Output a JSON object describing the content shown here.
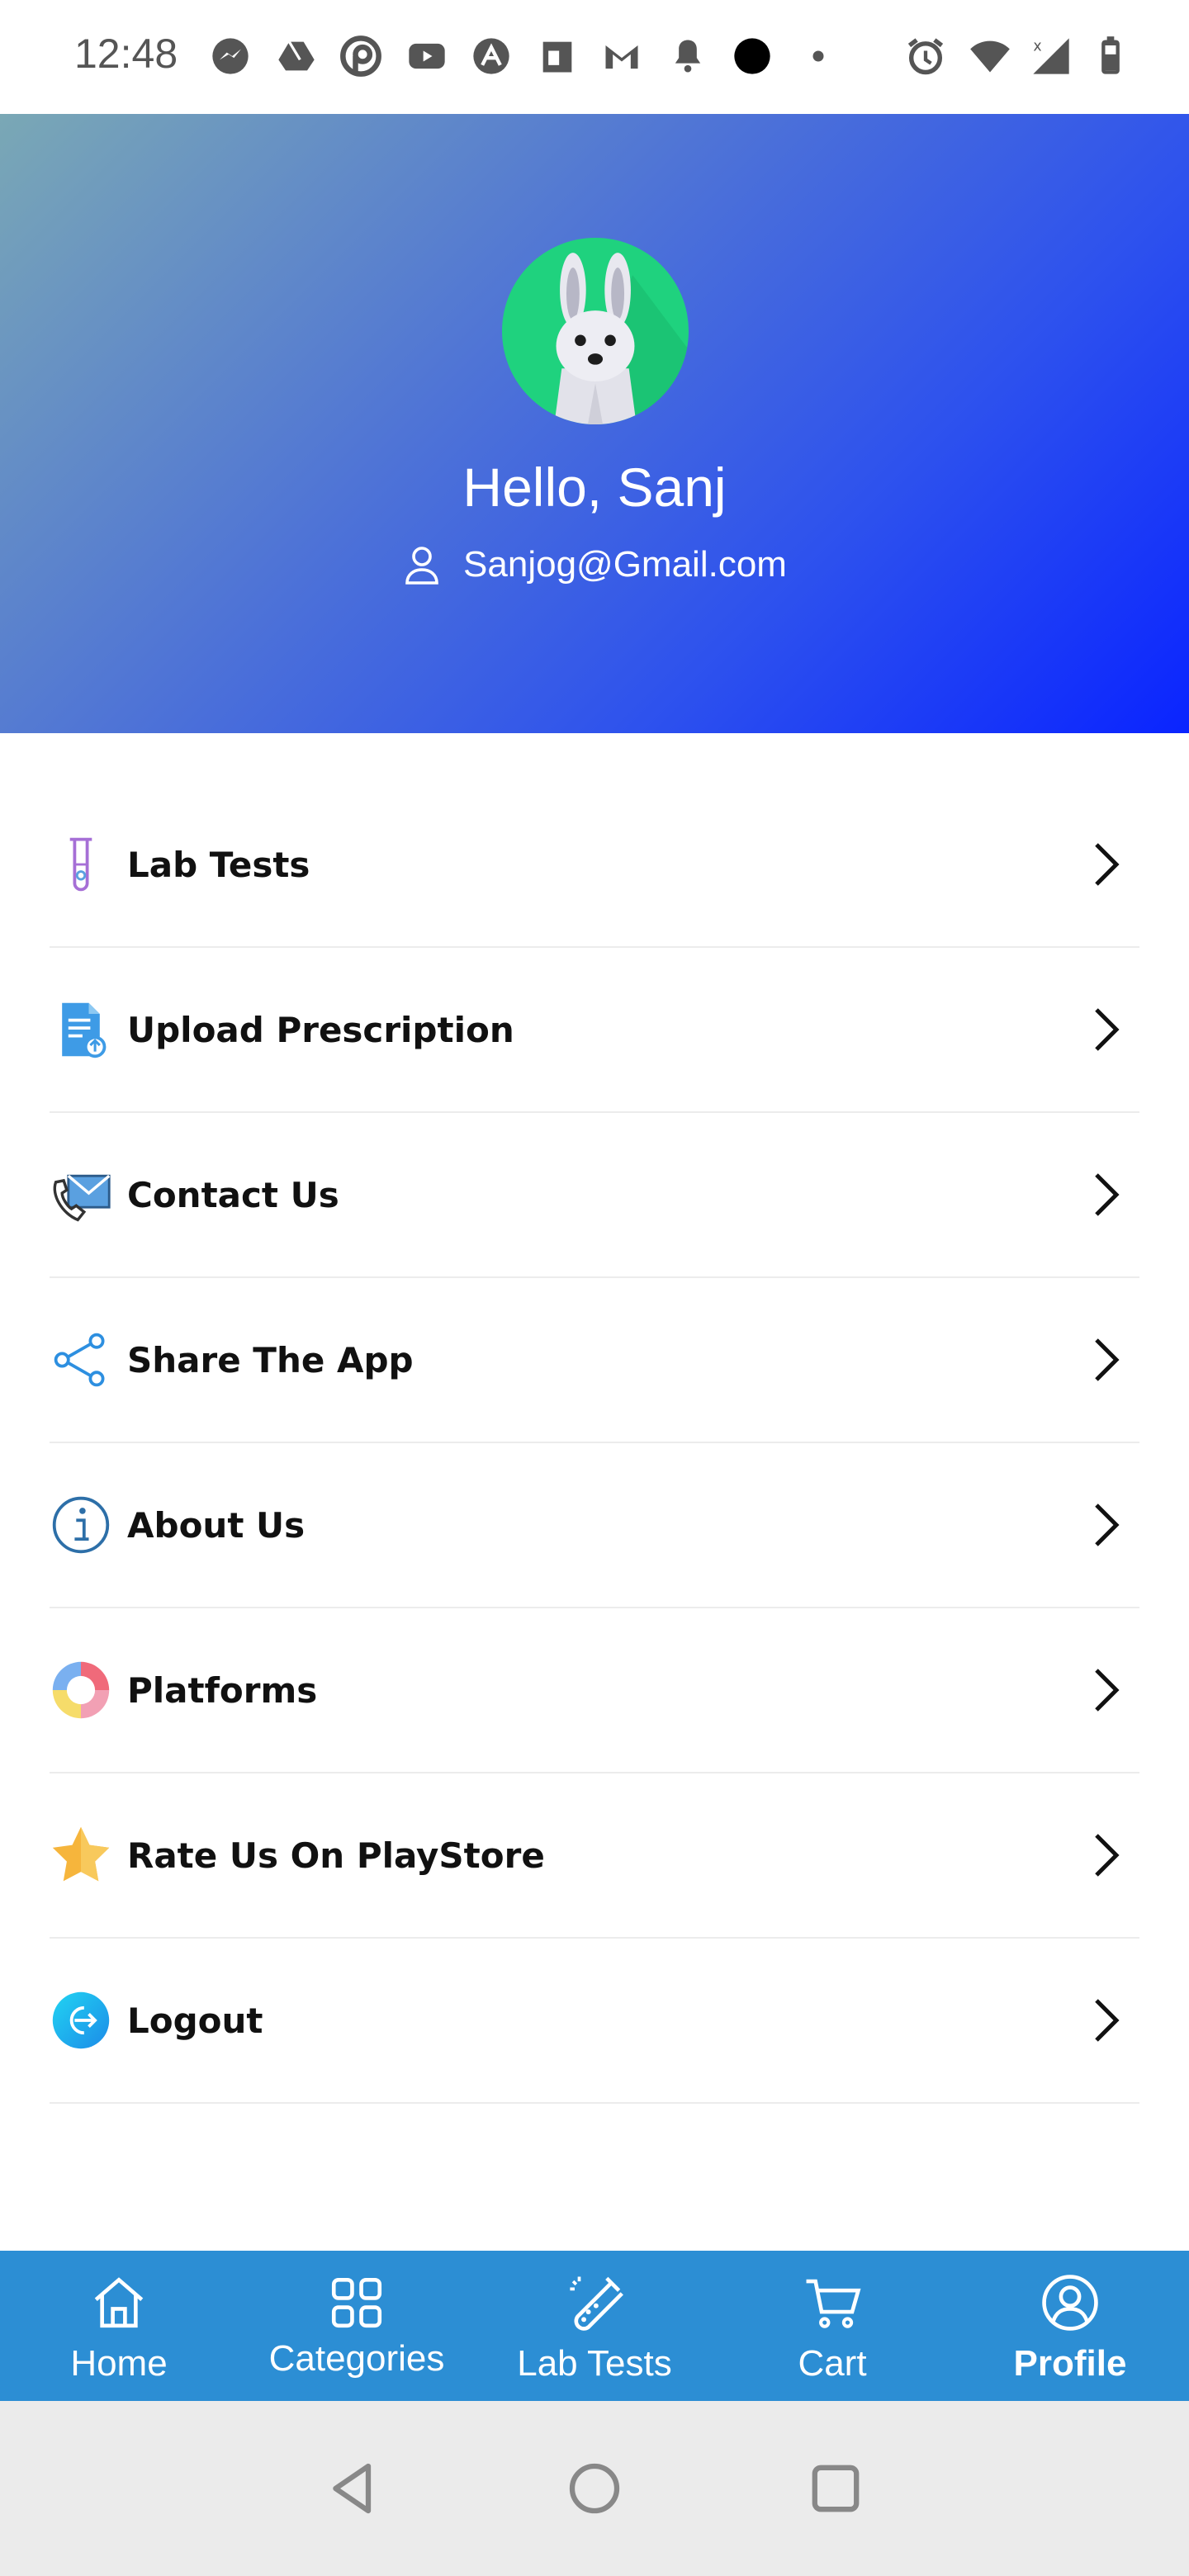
{
  "status_bar": {
    "time": "12:48",
    "notification_icons": [
      "messenger-icon",
      "drive-icon",
      "pocket-icon",
      "youtube-icon",
      "arch-icon",
      "calendar-icon",
      "gmail-icon",
      "bell-icon",
      "dot-icon",
      "small-dot-icon"
    ],
    "system_icons": [
      "alarm-icon",
      "wifi-icon",
      "signal-icon",
      "battery-icon"
    ]
  },
  "profile": {
    "greeting": "Hello, Sanj",
    "email": "Sanjog@Gmail.com",
    "avatar_bg": "#1fd27e"
  },
  "menu": [
    {
      "label": "Lab Tests",
      "icon": "test-tube-icon"
    },
    {
      "label": "Upload Prescription",
      "icon": "prescription-upload-icon"
    },
    {
      "label": "Contact Us",
      "icon": "contact-phone-mail-icon"
    },
    {
      "label": "Share The App",
      "icon": "share-icon"
    },
    {
      "label": "About Us",
      "icon": "info-icon"
    },
    {
      "label": "Platforms",
      "icon": "platforms-ring-icon"
    },
    {
      "label": "Rate Us On PlayStore",
      "icon": "star-icon"
    },
    {
      "label": "Logout",
      "icon": "logout-icon"
    }
  ],
  "bottom_nav": [
    {
      "label": "Home",
      "icon": "home-icon",
      "active": false
    },
    {
      "label": "Categories",
      "icon": "categories-grid-icon",
      "active": false
    },
    {
      "label": "Lab Tests",
      "icon": "lab-flask-icon",
      "active": false
    },
    {
      "label": "Cart",
      "icon": "cart-icon",
      "active": false
    },
    {
      "label": "Profile",
      "icon": "profile-circle-icon",
      "active": true
    }
  ],
  "colors": {
    "nav_bg": "#2c8ed4",
    "header_gradient_start": "#7aa8b5",
    "header_gradient_end": "#0a24ff"
  }
}
